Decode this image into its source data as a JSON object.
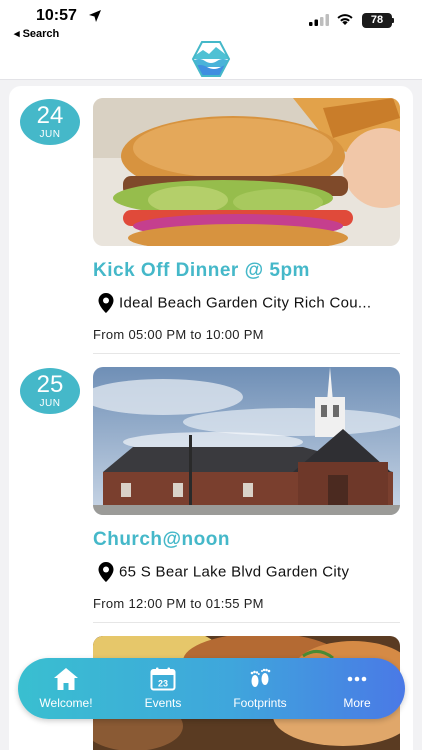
{
  "status": {
    "time": "10:57",
    "back_label": "◂ Search",
    "battery": "78"
  },
  "events": [
    {
      "day": "24",
      "month": "JUN",
      "title": "Kick Off Dinner @ 5pm",
      "location": "Ideal Beach Garden City Rich Cou...",
      "time": "From 05:00 PM to 10:00 PM",
      "image": "burger-photo"
    },
    {
      "day": "25",
      "month": "JUN",
      "title": "Church@noon",
      "location": "65 S Bear Lake Blvd Garden City",
      "time": "From 12:00 PM to 01:55 PM",
      "image": "church-photo"
    },
    {
      "image": "grilled-food-photo"
    }
  ],
  "tabs": [
    {
      "label": "Welcome!",
      "icon": "home-icon"
    },
    {
      "label": "Events",
      "icon": "calendar-icon",
      "icon_text": "23"
    },
    {
      "label": "Footprints",
      "icon": "footprints-icon"
    },
    {
      "label": "More",
      "icon": "more-icon"
    }
  ],
  "colors": {
    "accent": "#45b8c9",
    "tab_gradient_start": "#39bfd0",
    "tab_gradient_end": "#4a79e6"
  }
}
